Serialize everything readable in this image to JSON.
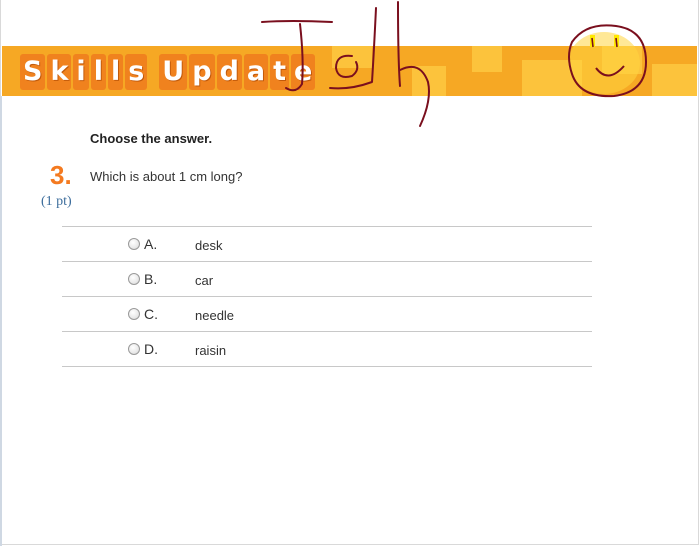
{
  "banner": {
    "title_letters": [
      "S",
      "k",
      "i",
      "l",
      "l",
      "s",
      " ",
      "U",
      "p",
      "d",
      "a",
      "t",
      "e"
    ]
  },
  "question": {
    "instruction": "Choose the answer.",
    "number": "3.",
    "points": "(1 pt)",
    "text": "Which is about 1 cm long?"
  },
  "options": [
    {
      "letter": "A.",
      "text": "desk"
    },
    {
      "letter": "B.",
      "text": "car"
    },
    {
      "letter": "C.",
      "text": "needle"
    },
    {
      "letter": "D.",
      "text": "raisin"
    }
  ],
  "colors": {
    "banner": "#f6a824",
    "banner_tile": "#fcc33c",
    "question_number": "#f47a20",
    "points": "#3c6d9c",
    "doodle_ink": "#7a0f1e"
  },
  "icons": [
    "radio-button-icon",
    "smiley-doodle-icon"
  ]
}
